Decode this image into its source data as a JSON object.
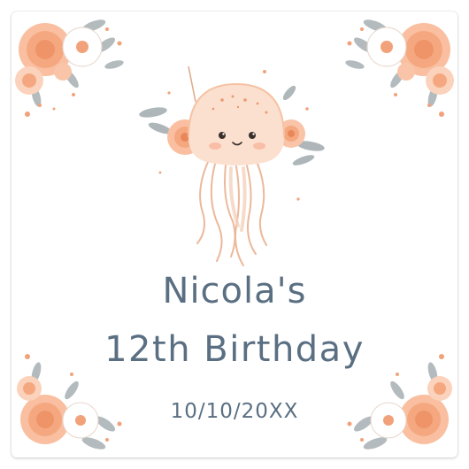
{
  "sticker": {
    "name_line": "Nicola's",
    "occasion_line": "12th Birthday",
    "date_line": "10/10/20XX"
  },
  "colors": {
    "text": "#5a6f82",
    "peach": "#f5a880",
    "peach_light": "#fbd2bb",
    "leaf_gray": "#9aa5a8",
    "background": "#ffffff"
  },
  "decorations": [
    "floral-corner-icon",
    "jellyfish-icon"
  ]
}
